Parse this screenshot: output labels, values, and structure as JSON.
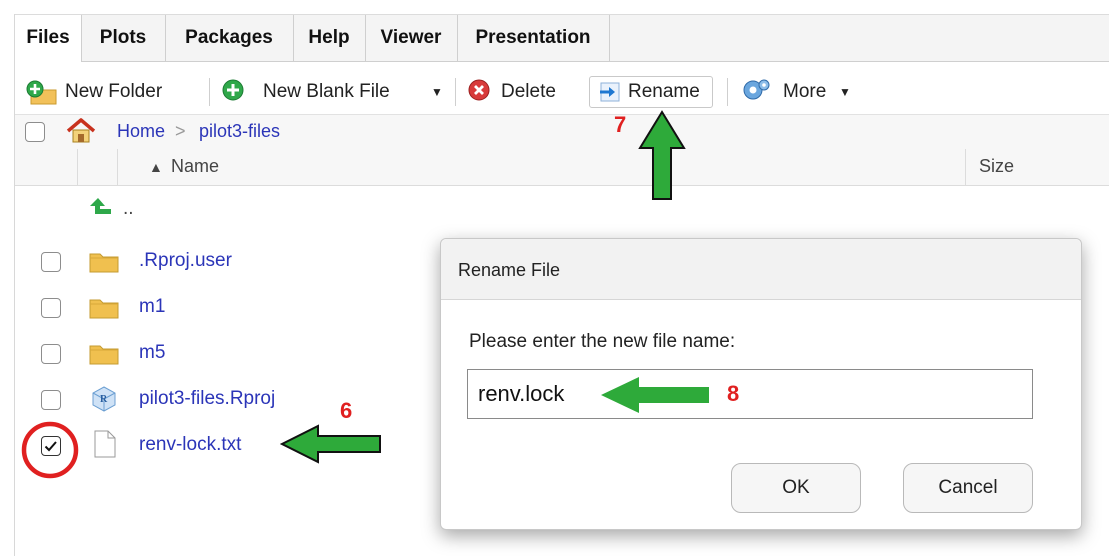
{
  "tabs": [
    {
      "label": "Files"
    },
    {
      "label": "Plots"
    },
    {
      "label": "Packages"
    },
    {
      "label": "Help"
    },
    {
      "label": "Viewer"
    },
    {
      "label": "Presentation"
    }
  ],
  "toolbar": {
    "new_folder": "New Folder",
    "new_blank_file": "New Blank File",
    "delete": "Delete",
    "rename": "Rename",
    "more": "More"
  },
  "breadcrumb": {
    "home": "Home",
    "separator": ">",
    "folder": "pilot3-files"
  },
  "columns": {
    "name": "Name",
    "size": "Size"
  },
  "files": [
    {
      "name": "..",
      "type": "parent"
    },
    {
      "name": ".Rproj.user",
      "type": "folder",
      "checked": false
    },
    {
      "name": "m1",
      "type": "folder",
      "checked": false
    },
    {
      "name": "m5",
      "type": "folder",
      "checked": false
    },
    {
      "name": "pilot3-files.Rproj",
      "type": "rproj",
      "checked": false
    },
    {
      "name": "renv-lock.txt",
      "type": "file",
      "checked": true
    }
  ],
  "dialog": {
    "title": "Rename File",
    "prompt": "Please enter the new file name:",
    "input_value": "renv.lock",
    "ok": "OK",
    "cancel": "Cancel"
  },
  "annotations": {
    "step6": "6",
    "step7": "7",
    "step8": "8"
  },
  "colors": {
    "link": "#2b35b8",
    "annotation_red": "#e02020",
    "arrow_green": "#2eaa3a"
  }
}
